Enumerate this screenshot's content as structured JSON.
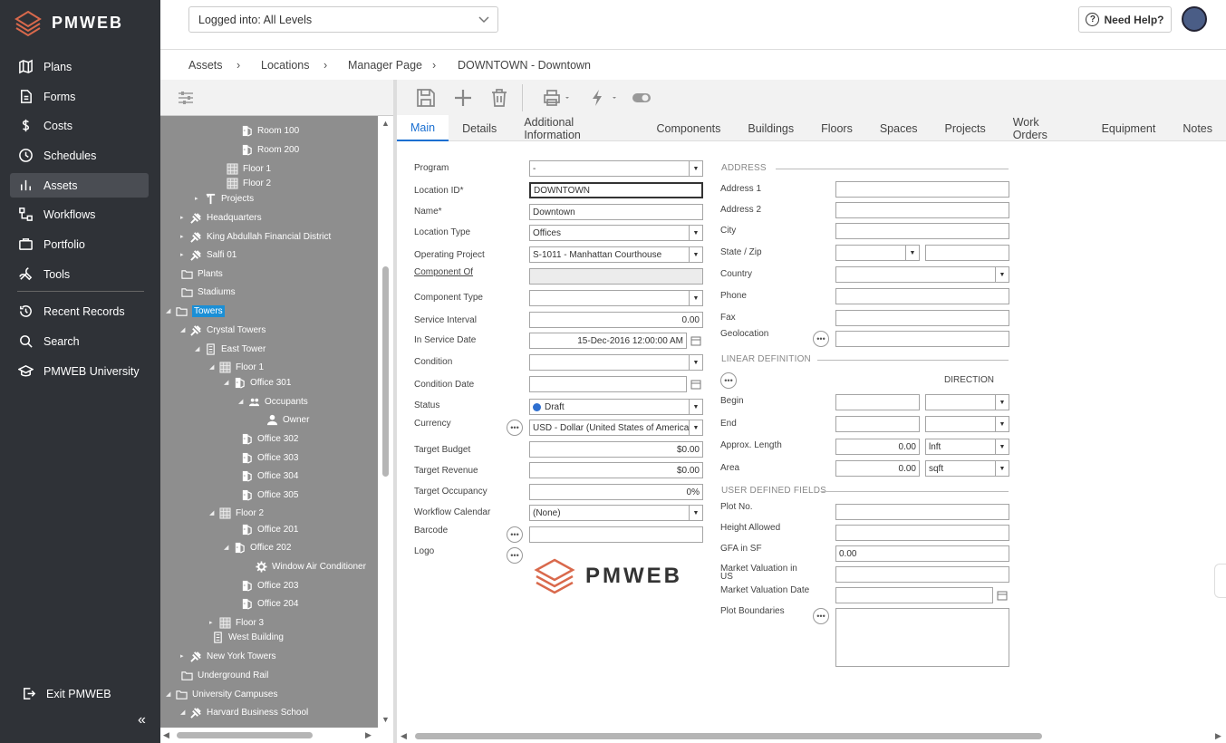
{
  "app": {
    "logo_text": "PMWEB"
  },
  "nav": {
    "items": [
      {
        "label": "Plans",
        "icon": "map-icon"
      },
      {
        "label": "Forms",
        "icon": "document-icon"
      },
      {
        "label": "Costs",
        "icon": "dollar-icon"
      },
      {
        "label": "Schedules",
        "icon": "clock-icon"
      },
      {
        "label": "Assets",
        "icon": "bar-chart-icon"
      },
      {
        "label": "Workflows",
        "icon": "workflow-icon"
      },
      {
        "label": "Portfolio",
        "icon": "briefcase-icon"
      },
      {
        "label": "Tools",
        "icon": "tools-icon"
      },
      {
        "label": "Recent Records",
        "icon": "history-icon"
      },
      {
        "label": "Search",
        "icon": "search-icon"
      },
      {
        "label": "PMWEB University",
        "icon": "graduation-cap-icon"
      }
    ],
    "exit_label": "Exit PMWEB"
  },
  "header": {
    "level_select": "Logged into: All Levels",
    "help_label": "Need Help?"
  },
  "breadcrumb": [
    "Assets",
    "Locations",
    "Manager Page",
    "DOWNTOWN - Downtown"
  ],
  "tree": {
    "nodes": [
      {
        "label": "Room 100",
        "icon": "door-icon"
      },
      {
        "label": "Room 200",
        "icon": "door-icon"
      },
      {
        "label": "Floor 1",
        "icon": "floor-icon"
      },
      {
        "label": "Floor 2",
        "icon": "floor-icon"
      },
      {
        "label": "Projects",
        "icon": "projects-icon",
        "arrow": "▸"
      },
      {
        "label": "Headquarters",
        "icon": "location-icon",
        "arrow": "▸"
      },
      {
        "label": "King Abdullah Financial District",
        "icon": "location-icon",
        "arrow": "▸"
      },
      {
        "label": "Salfi 01",
        "icon": "location-icon",
        "arrow": "▸"
      },
      {
        "label": "Plants",
        "icon": "folder-icon"
      },
      {
        "label": "Stadiums",
        "icon": "folder-icon"
      },
      {
        "label": "Towers",
        "icon": "folder-icon",
        "arrow": "◢"
      },
      {
        "label": "Crystal Towers",
        "icon": "location-icon",
        "arrow": "◢"
      },
      {
        "label": "East Tower",
        "icon": "building-icon",
        "arrow": "◢"
      },
      {
        "label": "Floor 1",
        "icon": "floor-icon",
        "arrow": "◢"
      },
      {
        "label": "Office 301",
        "icon": "door-icon",
        "arrow": "◢"
      },
      {
        "label": "Occupants",
        "icon": "people-icon",
        "arrow": "◢"
      },
      {
        "label": "Owner",
        "icon": "person-icon"
      },
      {
        "label": "Office 302",
        "icon": "door-icon"
      },
      {
        "label": "Office 303",
        "icon": "door-icon"
      },
      {
        "label": "Office 304",
        "icon": "door-icon"
      },
      {
        "label": "Office 305",
        "icon": "door-icon"
      },
      {
        "label": "Floor 2",
        "icon": "floor-icon",
        "arrow": "◢"
      },
      {
        "label": "Office 201",
        "icon": "door-icon"
      },
      {
        "label": "Office 202",
        "icon": "door-icon",
        "arrow": "◢"
      },
      {
        "label": "Window Air Conditioner",
        "icon": "gear-icon"
      },
      {
        "label": "Office 203",
        "icon": "door-icon"
      },
      {
        "label": "Office 204",
        "icon": "door-icon"
      },
      {
        "label": "Floor 3",
        "icon": "floor-icon",
        "arrow": "▸"
      },
      {
        "label": "West Building",
        "icon": "building-icon"
      },
      {
        "label": "New York Towers",
        "icon": "location-icon",
        "arrow": "▸"
      },
      {
        "label": "Underground Rail",
        "icon": "folder-icon"
      },
      {
        "label": "University Campuses",
        "icon": "folder-icon",
        "arrow": "◢"
      },
      {
        "label": "Harvard Business School",
        "icon": "location-icon",
        "arrow": "◢"
      }
    ]
  },
  "tabs": [
    "Main",
    "Details",
    "Additional Information",
    "Components",
    "Buildings",
    "Floors",
    "Spaces",
    "Projects",
    "Work Orders",
    "Equipment",
    "Notes"
  ],
  "form": {
    "program": {
      "label": "Program",
      "value": "-"
    },
    "location_id": {
      "label": "Location ID*",
      "value": "DOWNTOWN"
    },
    "name": {
      "label": "Name*",
      "value": "Downtown"
    },
    "location_type": {
      "label": "Location Type",
      "value": "Offices"
    },
    "operating_project": {
      "label": "Operating Project",
      "value": "S-1011 - Manhattan Courthouse"
    },
    "component_of": {
      "label": "Component Of",
      "value": ""
    },
    "component_type": {
      "label": "Component Type",
      "value": ""
    },
    "service_interval": {
      "label": "Service Interval",
      "value": "0.00"
    },
    "in_service_date": {
      "label": "In Service Date",
      "value": "15-Dec-2016 12:00:00 AM"
    },
    "condition": {
      "label": "Condition",
      "value": ""
    },
    "condition_date": {
      "label": "Condition Date",
      "value": ""
    },
    "status": {
      "label": "Status",
      "value": "Draft"
    },
    "currency": {
      "label": "Currency",
      "value": "USD - Dollar (United States of America"
    },
    "target_budget": {
      "label": "Target Budget",
      "value": "$0.00"
    },
    "target_revenue": {
      "label": "Target Revenue",
      "value": "$0.00"
    },
    "target_occupancy": {
      "label": "Target Occupancy",
      "value": "0%"
    },
    "workflow_calendar": {
      "label": "Workflow Calendar",
      "value": "(None)"
    },
    "barcode": {
      "label": "Barcode",
      "value": ""
    },
    "logo": {
      "label": "Logo",
      "value": "PMWEB"
    }
  },
  "address": {
    "section": "ADDRESS",
    "address1": "Address 1",
    "address2": "Address 2",
    "city": "City",
    "state_zip": "State / Zip",
    "country": "Country",
    "phone": "Phone",
    "fax": "Fax",
    "geolocation": "Geolocation"
  },
  "linear": {
    "section": "LINEAR DEFINITION",
    "direction": "DIRECTION",
    "begin": "Begin",
    "end": "End",
    "approx_length": {
      "label": "Approx. Length",
      "value": "0.00",
      "unit": "lnft"
    },
    "area": {
      "label": "Area",
      "value": "0.00",
      "unit": "sqft"
    }
  },
  "udf": {
    "section": "USER DEFINED FIELDS",
    "plot_no": "Plot No.",
    "height_allowed": "Height Allowed",
    "gfa": {
      "label": "GFA in SF",
      "value": "0.00"
    },
    "market_valuation": "Market Valuation in US",
    "market_valuation_date": "Market Valuation Date",
    "plot_boundaries": "Plot Boundaries"
  },
  "colors": {
    "sidebar": "#2f3237",
    "accent": "#1a6fd1",
    "brand": "#d9694c",
    "tree_bg": "#8e8e8e",
    "selected": "#1a8fd6"
  }
}
